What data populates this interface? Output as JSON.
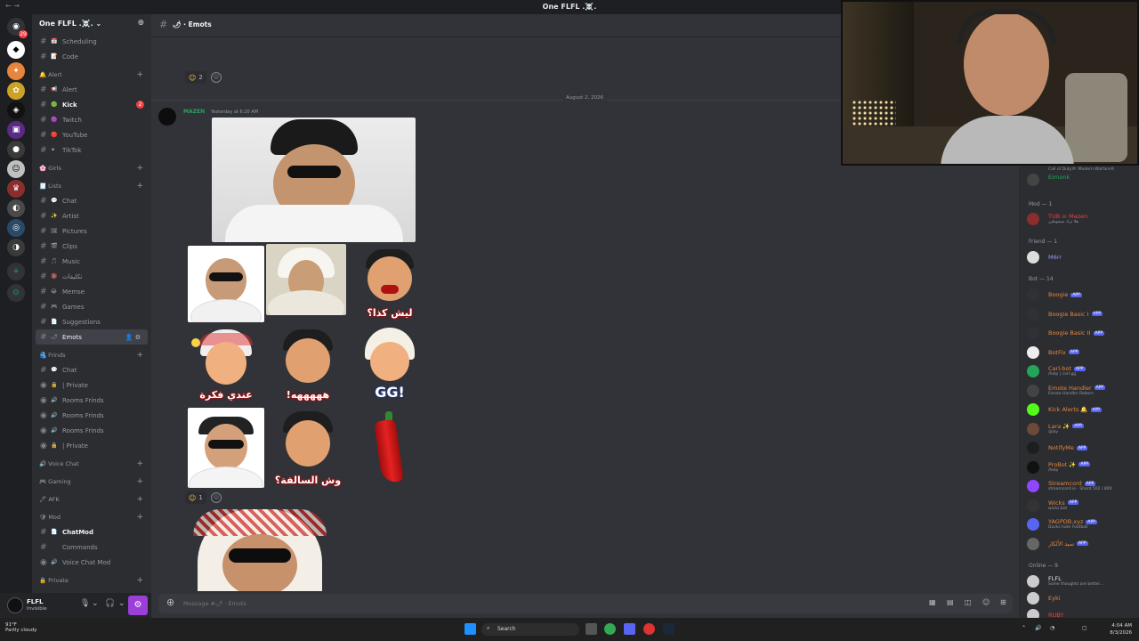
{
  "window": {
    "title": "One FLFL .☠️."
  },
  "server": {
    "name": "One FLFL .☠️."
  },
  "channels": [
    {
      "type": "channel",
      "emoji": "📅",
      "label": "Scheduling"
    },
    {
      "type": "channel",
      "emoji": "📝",
      "label": "Code"
    },
    {
      "type": "category",
      "label": "🔔 Alert"
    },
    {
      "type": "channel",
      "emoji": "📢",
      "label": "Alert"
    },
    {
      "type": "channel",
      "emoji": "🟢",
      "label": "Kick",
      "bold": true,
      "mention": "2"
    },
    {
      "type": "channel",
      "emoji": "🟣",
      "label": "Twitch"
    },
    {
      "type": "channel",
      "emoji": "🔴",
      "label": "YouTube"
    },
    {
      "type": "channel",
      "emoji": "⚫",
      "label": "TikTok"
    },
    {
      "type": "category",
      "label": "🌸 Girls"
    },
    {
      "type": "category",
      "label": "🧾 Lists"
    },
    {
      "type": "channel",
      "emoji": "💬",
      "label": "Chat"
    },
    {
      "type": "channel",
      "emoji": "✨",
      "label": "Artist"
    },
    {
      "type": "channel",
      "emoji": "🖼",
      "label": "Pictures"
    },
    {
      "type": "channel",
      "emoji": "🎬",
      "label": "Clips"
    },
    {
      "type": "channel",
      "emoji": "🎵",
      "label": "Music"
    },
    {
      "type": "channel",
      "emoji": "🔞",
      "label": "تكليفات"
    },
    {
      "type": "channel",
      "emoji": "😂",
      "label": "Memse"
    },
    {
      "type": "channel",
      "emoji": "🎮",
      "label": "Games"
    },
    {
      "type": "channel",
      "emoji": "📄",
      "label": "Suggestions"
    },
    {
      "type": "channel",
      "emoji": "🌶",
      "label": "Emots",
      "active": true
    },
    {
      "type": "category",
      "label": "🫂 Frinds"
    },
    {
      "type": "channel",
      "emoji": "💬",
      "label": "Chat"
    },
    {
      "type": "voice",
      "emoji": "🔒",
      "label": "| Private"
    },
    {
      "type": "voice",
      "emoji": "🔊",
      "label": "Rooms Frinds"
    },
    {
      "type": "voice",
      "emoji": "🔊",
      "label": "Rooms Frinds"
    },
    {
      "type": "voice",
      "emoji": "🔊",
      "label": "Rooms Frinds"
    },
    {
      "type": "voice",
      "emoji": "🔒",
      "label": "| Private"
    },
    {
      "type": "category",
      "label": "🔊 Voice Chat"
    },
    {
      "type": "category",
      "label": "🎮 Gaming"
    },
    {
      "type": "category",
      "label": "🖊 AFK"
    },
    {
      "type": "category",
      "label": "🛡 Mod"
    },
    {
      "type": "channel",
      "emoji": "📄",
      "label": "ChatMod",
      "bold": true
    },
    {
      "type": "channel",
      "emoji": "",
      "label": "Commands"
    },
    {
      "type": "voice",
      "emoji": "🔊",
      "label": "Voice Chat Mod"
    },
    {
      "type": "category",
      "label": "🔒 Private"
    }
  ],
  "user": {
    "name": "FLFL",
    "status": "Invisible"
  },
  "channel_header": {
    "name": "🌶 · Emots"
  },
  "reactions": {
    "first": "2",
    "second": "1"
  },
  "date_divider": "August 2, 2026",
  "message": {
    "author": "MAZEN",
    "time": "Yesterday at 6:20 AM"
  },
  "emotes": {
    "caption_1": "ليش كذا؟",
    "caption_2": "عندي فكرة",
    "caption_3": "!هههههه",
    "caption_4": "GG!",
    "caption_5": "وش السالفة؟"
  },
  "composer": {
    "placeholder": "Message #🌶 · Emots"
  },
  "member_list": {
    "top_member": {
      "name": "Eimonk",
      "sub": "Call of Duty®: Modern Warfare®"
    },
    "groups": {
      "mod": "Mod — 1",
      "friend": "Friend — 1",
      "bot": "Bot — 14",
      "online": "Online — 9"
    },
    "mod_member": {
      "name": "TUB ☠ Mazen",
      "sub": "هلا ترك مبسوطين"
    },
    "friend_member": {
      "name": "M6rr"
    },
    "bots": [
      {
        "name": "Boogie",
        "sub": "",
        "color": "#e8853d"
      },
      {
        "name": "Boogie Basic I",
        "sub": "",
        "color": "#e8853d"
      },
      {
        "name": "Boogie Basic II",
        "sub": "",
        "color": "#e8853d"
      },
      {
        "name": "BotFix",
        "sub": "",
        "color": "#e8853d"
      },
      {
        "name": "Carl-bot",
        "sub": "/help | carl.gg",
        "color": "#e8853d"
      },
      {
        "name": "Emote Handler",
        "sub": "Emote Handler Reborn",
        "color": "#e8853d"
      },
      {
        "name": "Kick Alerts 🔔",
        "sub": "",
        "color": "#e8853d"
      },
      {
        "name": "Lara ✨",
        "sub": "/play",
        "color": "#e8853d"
      },
      {
        "name": "NotifyMe",
        "sub": "",
        "color": "#e8853d"
      },
      {
        "name": "ProBot ✨",
        "sub": "/help",
        "color": "#e8853d"
      },
      {
        "name": "Streamcord",
        "sub": "streamcord.io · Shard 502 / 800",
        "color": "#e8853d"
      },
      {
        "name": "Wicks",
        "sub": "wicks.bot",
        "color": "#e8853d"
      },
      {
        "name": "YAGPDB.xyz",
        "sub": "Ducks hate Football",
        "color": "#e8853d"
      },
      {
        "name": "سيد الألكار",
        "sub": "",
        "color": "#e8853d"
      }
    ],
    "app_tag": "APP",
    "online": [
      {
        "name": "FLFL",
        "sub": "Some thoughts are better..."
      },
      {
        "name": "Eyki",
        "sub": ""
      },
      {
        "name": "RUBY",
        "sub": ""
      }
    ]
  },
  "taskbar": {
    "weather_temp": "91°F",
    "weather_text": "Partly cloudy",
    "search_label": "Search",
    "time": "4:04 AM",
    "date": "8/3/2026"
  },
  "colors": {
    "bot_name": "#e8853d",
    "mention_red": "#f23f43",
    "online_green": "#23a55a",
    "blurple": "#5865f2"
  }
}
